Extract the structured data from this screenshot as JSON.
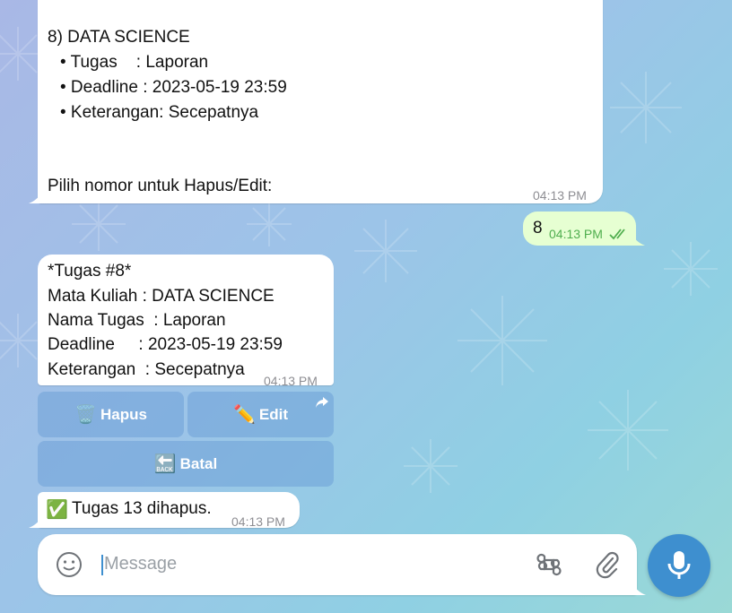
{
  "list_message": {
    "item_header": "8) DATA SCIENCE",
    "lines": [
      "• Tugas    : Laporan",
      "• Deadline : 2023-05-19 23:59",
      "• Keterangan: Secepatnya"
    ],
    "prompt": "Pilih nomor untuk Hapus/Edit:",
    "time": "04:13 PM"
  },
  "user_message": {
    "text": "8",
    "time": "04:13 PM"
  },
  "detail_message": {
    "lines": [
      "*Tugas #8*",
      "Mata Kuliah : DATA SCIENCE",
      "Nama Tugas  : Laporan",
      "Deadline     : 2023-05-19 23:59",
      "Keterangan  : Secepatnya"
    ],
    "time": "04:13 PM"
  },
  "keyboard": {
    "hapus_emoji": "🗑️",
    "hapus_label": "Hapus",
    "edit_emoji": "✏️",
    "edit_label": "Edit",
    "batal_emoji": "🔙",
    "batal_label": "Batal"
  },
  "deleted_message": {
    "emoji": "✅",
    "text": "Tugas 13 dihapus.",
    "time": "04:13 PM"
  },
  "composer": {
    "placeholder": "Message"
  },
  "colors": {
    "accent": "#3e8fcf",
    "outgoing_bubble": "#e6ffd2",
    "mic_button": "#3e8fcf"
  }
}
